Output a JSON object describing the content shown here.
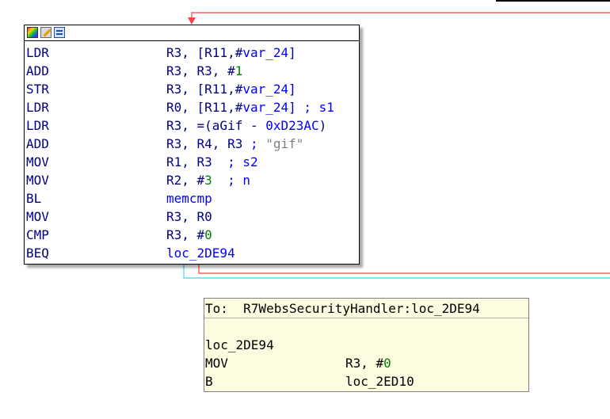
{
  "colors": {
    "edge_false": "#ff4040",
    "edge_true": "#3fd8e8",
    "mnemonic": "#000080",
    "number": "#008000",
    "name_ref": "#0000ff",
    "string_comment": "#808080",
    "hint_background": "#fdfce0"
  },
  "toolbar": {
    "icons": [
      "color-palette-icon",
      "edit-pencil-icon",
      "graph-overview-icon"
    ]
  },
  "block": {
    "lines": [
      {
        "mnemonic": "LDR",
        "p1": "R3, [R11,#",
        "p2": "var_24",
        "p3": "]",
        "p4": "",
        "p5": ""
      },
      {
        "mnemonic": "ADD",
        "p1": "R3, R3, #",
        "p2": "1",
        "p3": "",
        "p4": "",
        "p5": ""
      },
      {
        "mnemonic": "STR",
        "p1": "R3, [R11,#",
        "p2": "var_24",
        "p3": "]",
        "p4": "",
        "p5": ""
      },
      {
        "mnemonic": "LDR",
        "p1": "R0, [R11,#",
        "p2": "var_24",
        "p3": "] ",
        "p4": "; s1",
        "p5": ""
      },
      {
        "mnemonic": "LDR",
        "p1": "R3, =(aGif - ",
        "p2": "0xD23AC",
        "p3": ")",
        "p4": "",
        "p5": ""
      },
      {
        "mnemonic": "ADD",
        "p1": "R3, R4, R3 ",
        "p2": "",
        "p3": "",
        "p4": "; ",
        "p5": "\"gif\""
      },
      {
        "mnemonic": "MOV",
        "p1": "R1, R3  ",
        "p2": "",
        "p3": "",
        "p4": "; s2",
        "p5": ""
      },
      {
        "mnemonic": "MOV",
        "p1": "R2, #",
        "p2": "3",
        "p3": "  ",
        "p4": "; n",
        "p5": ""
      },
      {
        "mnemonic": "BL",
        "p1": "",
        "p2": "memcmp",
        "p3": "",
        "p4": "",
        "p5": ""
      },
      {
        "mnemonic": "MOV",
        "p1": "R3, R0",
        "p2": "",
        "p3": "",
        "p4": "",
        "p5": ""
      },
      {
        "mnemonic": "CMP",
        "p1": "R3, #",
        "p2": "0",
        "p3": "",
        "p4": "",
        "p5": ""
      },
      {
        "mnemonic": "BEQ",
        "p1": "",
        "p2": "loc_2DE94",
        "p3": "",
        "p4": "",
        "p5": ""
      }
    ]
  },
  "hint": {
    "header": "To:  R7WebsSecurityHandler:loc_2DE94",
    "label": "loc_2DE94",
    "lines": [
      {
        "mnemonic": "MOV",
        "operand": "R3, #",
        "num": "0"
      },
      {
        "mnemonic": "B",
        "operand": "loc_2ED10",
        "num": ""
      }
    ]
  }
}
